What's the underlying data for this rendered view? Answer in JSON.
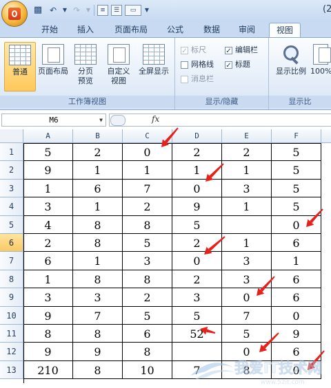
{
  "titlebar": {
    "right_text": "(2"
  },
  "tabs": [
    "开始",
    "插入",
    "页面布局",
    "公式",
    "数据",
    "审阅",
    "视图"
  ],
  "active_tab": "视图",
  "ribbon": {
    "workbook_views": {
      "label": "工作簿视图",
      "normal": "普通",
      "page_layout": "页面布局",
      "page_break_line1": "分页",
      "page_break_line2": "预览",
      "custom_line1": "自定义",
      "custom_line2": "视图",
      "fullscreen": "全屏显示"
    },
    "show_hide": {
      "label": "显示/隐藏",
      "ruler": "标尺",
      "gridlines": "网格线",
      "message_bar": "消息栏",
      "formula_bar": "编辑栏",
      "headings": "标题"
    },
    "zoom": {
      "label": "显示比",
      "zoom": "显示比例",
      "hundred": "100%"
    }
  },
  "formula_bar": {
    "name_box": "M6",
    "fx": "fx",
    "value": ""
  },
  "sheet": {
    "columns": [
      "A",
      "B",
      "C",
      "D",
      "E",
      "F"
    ],
    "rows": [
      "1",
      "2",
      "3",
      "4",
      "5",
      "6",
      "7",
      "8",
      "9",
      "10",
      "11",
      "12",
      "13"
    ],
    "selected_row": "6",
    "cells": [
      [
        "5",
        "2",
        "0",
        "2",
        "2",
        "5"
      ],
      [
        "9",
        "1",
        "1",
        "1",
        "1",
        "5"
      ],
      [
        "1",
        "6",
        "7",
        "0",
        "3",
        "5"
      ],
      [
        "3",
        "1",
        "2",
        "9",
        "1",
        "5"
      ],
      [
        "4",
        "8",
        "8",
        "5",
        "",
        "0"
      ],
      [
        "2",
        "8",
        "5",
        "2",
        "1",
        "6"
      ],
      [
        "6",
        "1",
        "3",
        "0",
        "3",
        "1"
      ],
      [
        "1",
        "8",
        "8",
        "2",
        "3",
        "6"
      ],
      [
        "3",
        "3",
        "2",
        "3",
        "0",
        "6"
      ],
      [
        "9",
        "7",
        "5",
        "5",
        "7",
        "0"
      ],
      [
        "8",
        "8",
        "6",
        "52",
        "5",
        "9"
      ],
      [
        "9",
        "9",
        "8",
        "",
        "0",
        "6"
      ],
      [
        "210",
        "8",
        "10",
        "7",
        "8",
        "0"
      ]
    ]
  },
  "colors": {
    "arrow": "#e8201a",
    "ribbon_bg": "#dfe9f7",
    "selected": "#ffc85a"
  },
  "watermark": {
    "text": "我爱IT技术网"
  }
}
